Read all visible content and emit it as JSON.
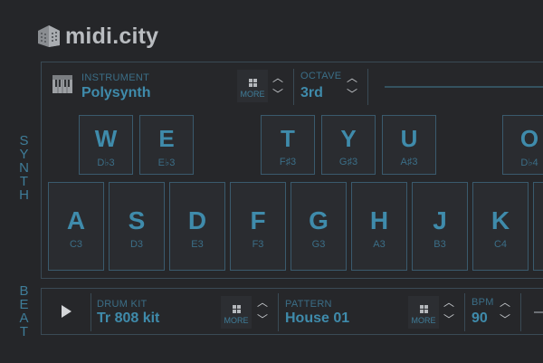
{
  "header": {
    "brand": "midi.city"
  },
  "synth": {
    "section_label": [
      "S",
      "Y",
      "N",
      "T",
      "H"
    ],
    "instrument": {
      "caption": "INSTRUMENT",
      "value": "Polysynth",
      "more_label": "MORE"
    },
    "octave": {
      "caption": "OCTAVE",
      "value": "3rd"
    },
    "black_keys": [
      {
        "letter": "W",
        "note": "D♭3"
      },
      {
        "letter": "E",
        "note": "E♭3"
      },
      {
        "letter": "T",
        "note": "F♯3"
      },
      {
        "letter": "Y",
        "note": "G♯3"
      },
      {
        "letter": "U",
        "note": "A♯3"
      },
      {
        "letter": "O",
        "note": "D♭4"
      }
    ],
    "white_keys": [
      {
        "letter": "A",
        "note": "C3"
      },
      {
        "letter": "S",
        "note": "D3"
      },
      {
        "letter": "D",
        "note": "E3"
      },
      {
        "letter": "F",
        "note": "F3"
      },
      {
        "letter": "G",
        "note": "G3"
      },
      {
        "letter": "H",
        "note": "A3"
      },
      {
        "letter": "J",
        "note": "B3"
      },
      {
        "letter": "K",
        "note": "C4"
      },
      {
        "letter": "",
        "note": ""
      }
    ]
  },
  "beat": {
    "section_label": [
      "B",
      "E",
      "A",
      "T"
    ],
    "drum_kit": {
      "caption": "DRUM KIT",
      "value": "Tr 808 kit",
      "more_label": "MORE"
    },
    "pattern": {
      "caption": "PATTERN",
      "value": "House 01",
      "more_label": "MORE"
    },
    "bpm": {
      "caption": "BPM",
      "value": "90"
    }
  },
  "icons": {
    "up": "chevron-up-icon",
    "down": "chevron-down-icon",
    "grid": "grid-icon",
    "play": "play-icon",
    "keyboard": "keyboard-icon",
    "logo": "building-logo-icon"
  },
  "colors": {
    "background": "#252629",
    "accent": "#3f8bab",
    "border": "#3a5a6d",
    "brand": "#b9bcc0"
  }
}
